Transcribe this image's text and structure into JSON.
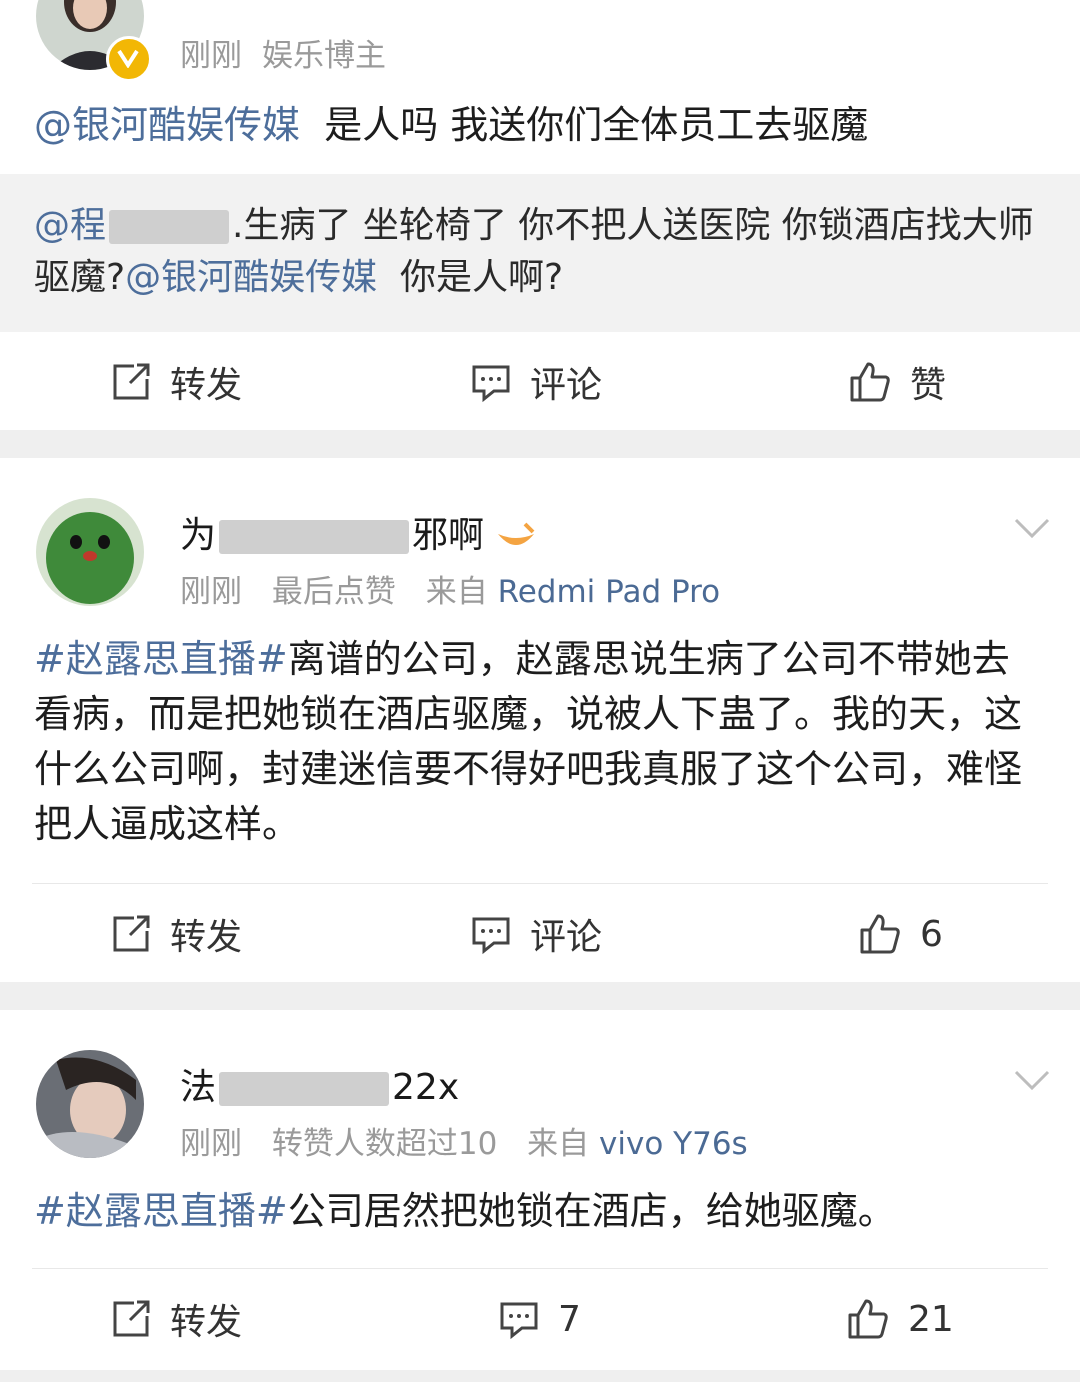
{
  "posts": [
    {
      "meta": {
        "time": "刚刚",
        "tag": "娱乐博主"
      },
      "text": {
        "mention": "@银河酷娱传媒",
        "body": "是人吗 我送你们全体员工去驱魔"
      },
      "quote": {
        "mention1": "@程",
        "body1": ".生病了 坐轮椅了 你不把人送医院 你锁酒店找大师驱魔?",
        "mention2": "@银河酷娱传媒",
        "body2": "你是人啊?"
      },
      "actions": {
        "repost": "转发",
        "comment": "评论",
        "like": "赞"
      }
    },
    {
      "handle": {
        "prefix": "为",
        "suffix": "邪啊"
      },
      "meta": {
        "time": "刚刚",
        "note": "最后点赞",
        "from": "来自",
        "device": "Redmi Pad Pro"
      },
      "text": {
        "hashtag": "#赵露思直播#",
        "body": "离谱的公司，赵露思说生病了公司不带她去看病，而是把她锁在酒店驱魔，说被人下蛊了。我的天，这什么公司啊，封建迷信要不得好吧我真服了这个公司，难怪把人逼成这样。"
      },
      "actions": {
        "repost": "转发",
        "comment": "评论",
        "like": "6"
      }
    },
    {
      "handle": {
        "prefix": "法",
        "suffix": "22x"
      },
      "meta": {
        "time": "刚刚",
        "note": "转赞人数超过10",
        "from": "来自",
        "device": "vivo Y76s"
      },
      "text": {
        "hashtag": "#赵露思直播#",
        "body": "公司居然把她锁在酒店，给她驱魔。"
      },
      "actions": {
        "repost": "转发",
        "comment": "7",
        "like": "21"
      }
    }
  ],
  "colors": {
    "link": "#4d6e9b",
    "meta": "#9a9a9a",
    "verified": "#f2b705"
  }
}
